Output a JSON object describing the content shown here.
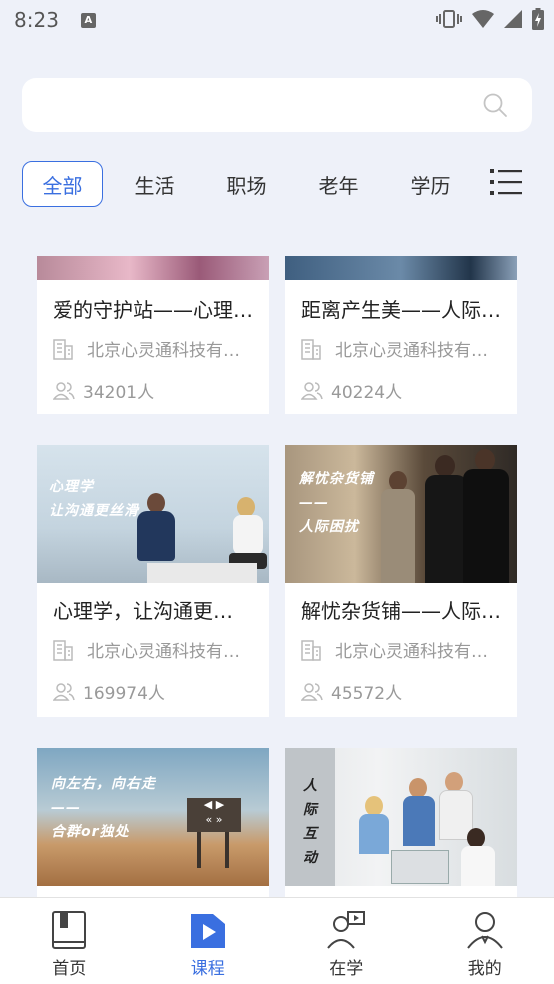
{
  "status": {
    "time": "8:23",
    "notif_icon": "A"
  },
  "search": {
    "placeholder": ""
  },
  "tabs": [
    {
      "label": "全部",
      "active": true
    },
    {
      "label": "生活",
      "active": false
    },
    {
      "label": "职场",
      "active": false
    },
    {
      "label": "老年",
      "active": false
    },
    {
      "label": "学历",
      "active": false
    }
  ],
  "courses": [
    {
      "title": "爱的守护站——心理…",
      "org": "北京心灵通科技有…",
      "count": "34201人"
    },
    {
      "title": "距离产生美——人际…",
      "org": "北京心灵通科技有…",
      "count": "40224人"
    },
    {
      "title": "心理学，让沟通更…",
      "org": "北京心灵通科技有…",
      "count": "169974人",
      "image_text": [
        "心理学",
        "让沟通更丝滑"
      ]
    },
    {
      "title": "解忧杂货铺——人际…",
      "org": "北京心灵通科技有…",
      "count": "45572人",
      "image_text": [
        "解忧杂货铺",
        "——",
        "人际困扰"
      ]
    },
    {
      "image_text": [
        "向左右，向右走",
        "——",
        "合群or独处"
      ]
    },
    {
      "image_text": [
        "人",
        "际",
        "互",
        "动"
      ]
    }
  ],
  "nav": [
    {
      "label": "首页",
      "icon": "book-icon",
      "active": false
    },
    {
      "label": "课程",
      "icon": "play-folder-icon",
      "active": true
    },
    {
      "label": "在学",
      "icon": "learning-person-icon",
      "active": false
    },
    {
      "label": "我的",
      "icon": "profile-icon",
      "active": false
    }
  ],
  "colors": {
    "accent": "#3a6fe0",
    "background": "#eef1f9",
    "muted_text": "#999999"
  }
}
